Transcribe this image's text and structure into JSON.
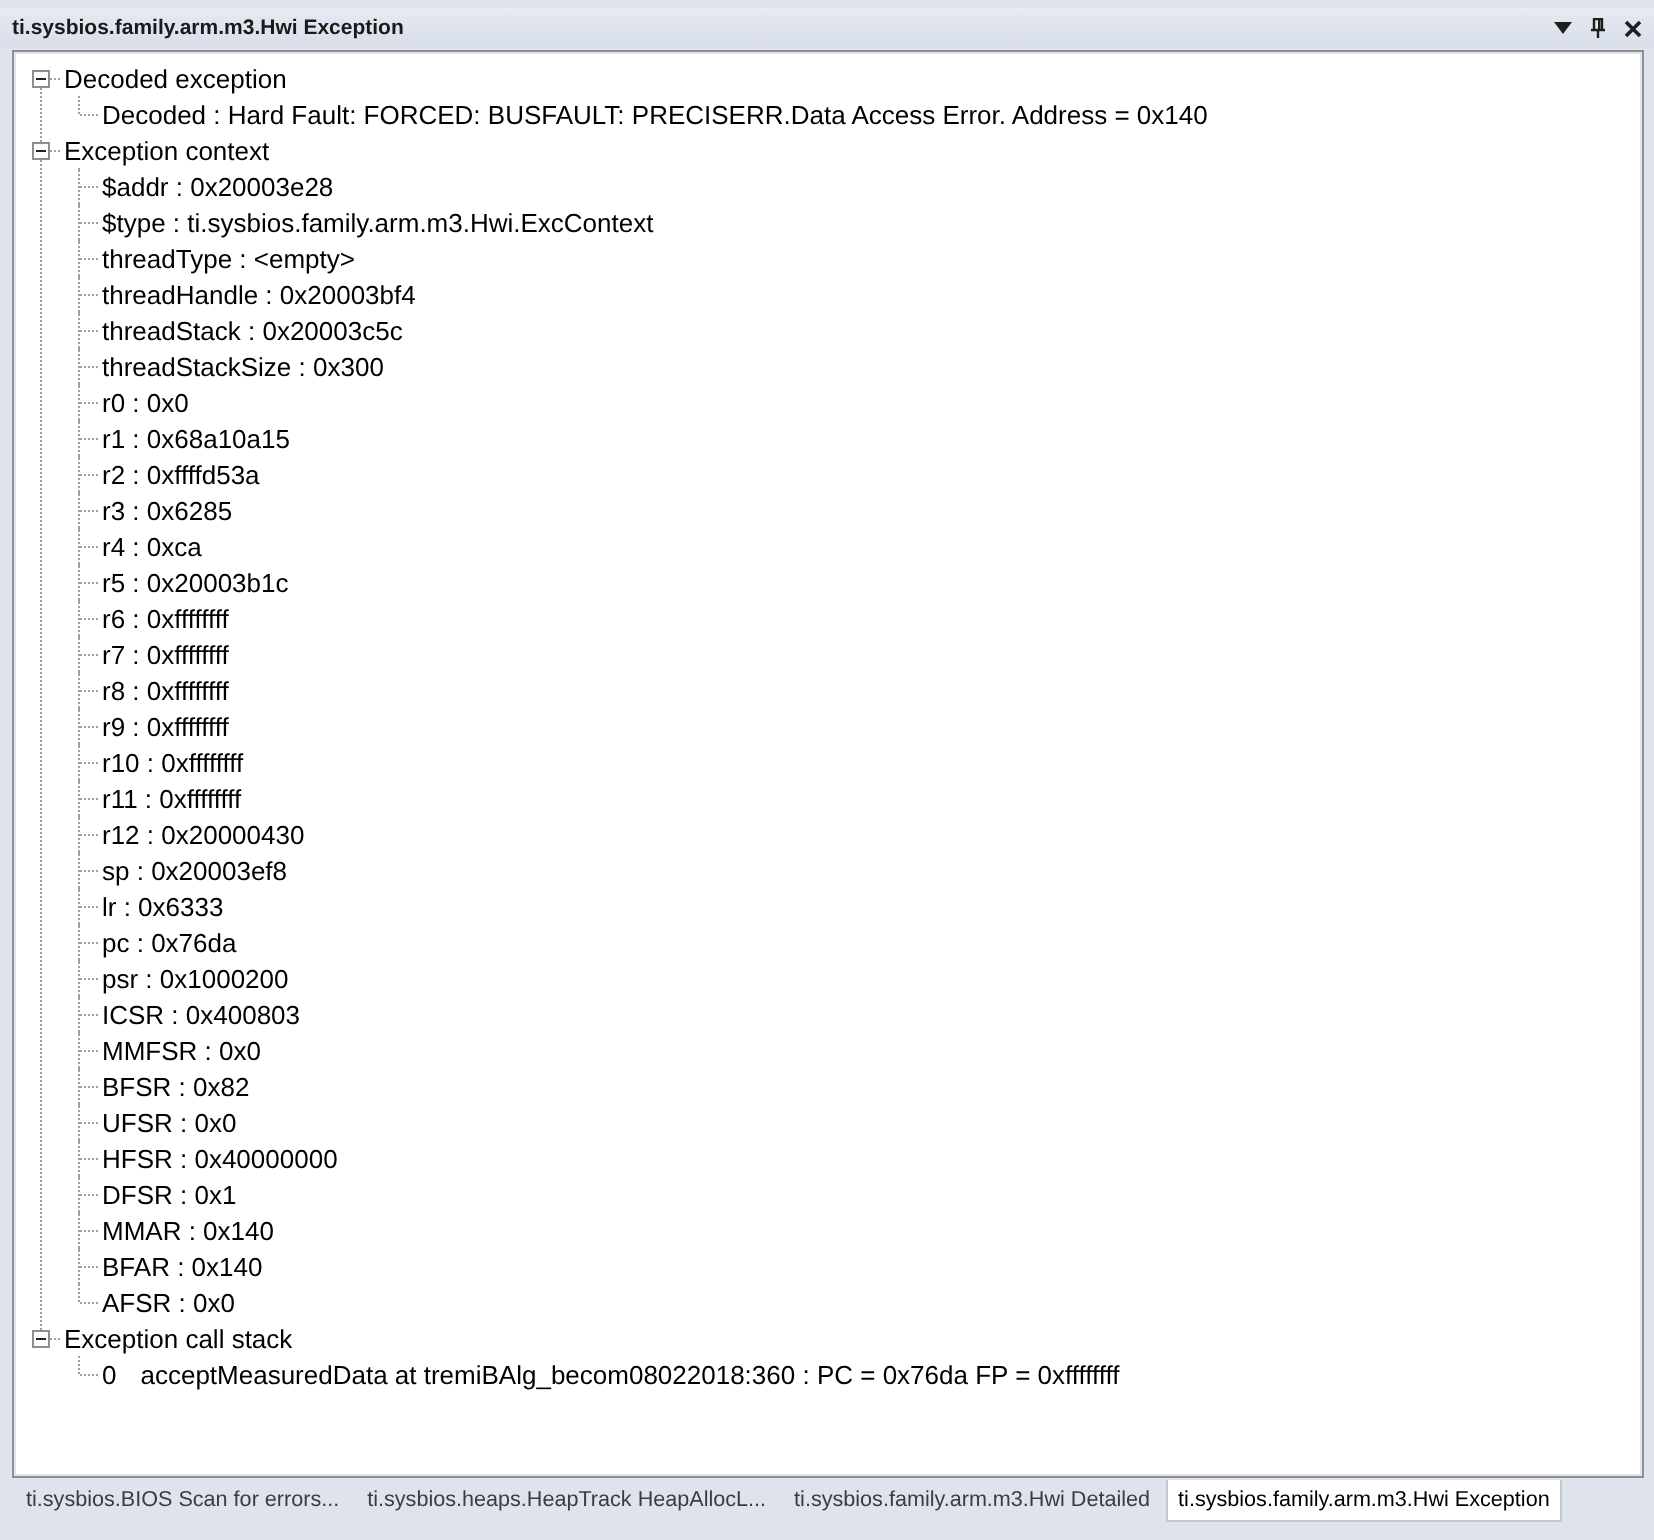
{
  "window": {
    "title": "ti.sysbios.family.arm.m3.Hwi Exception"
  },
  "tree": [
    {
      "label": "Decoded exception",
      "expanded": true,
      "children": [
        {
          "label": "Decoded : Hard Fault: FORCED: BUSFAULT: PRECISERR.Data Access Error. Address = 0x140"
        }
      ]
    },
    {
      "label": "Exception context",
      "expanded": true,
      "children": [
        {
          "label": "$addr : 0x20003e28"
        },
        {
          "label": "$type : ti.sysbios.family.arm.m3.Hwi.ExcContext"
        },
        {
          "label": "threadType : <empty>"
        },
        {
          "label": "threadHandle : 0x20003bf4"
        },
        {
          "label": "threadStack : 0x20003c5c"
        },
        {
          "label": "threadStackSize : 0x300"
        },
        {
          "label": "r0 : 0x0"
        },
        {
          "label": "r1 : 0x68a10a15"
        },
        {
          "label": "r2 : 0xffffd53a"
        },
        {
          "label": "r3 : 0x6285"
        },
        {
          "label": "r4 : 0xca"
        },
        {
          "label": "r5 : 0x20003b1c"
        },
        {
          "label": "r6 : 0xffffffff"
        },
        {
          "label": "r7 : 0xffffffff"
        },
        {
          "label": "r8 : 0xffffffff"
        },
        {
          "label": "r9 : 0xffffffff"
        },
        {
          "label": "r10 : 0xffffffff"
        },
        {
          "label": "r11 : 0xffffffff"
        },
        {
          "label": "r12 : 0x20000430"
        },
        {
          "label": "sp : 0x20003ef8"
        },
        {
          "label": "lr : 0x6333"
        },
        {
          "label": "pc : 0x76da"
        },
        {
          "label": "psr : 0x1000200"
        },
        {
          "label": "ICSR : 0x400803"
        },
        {
          "label": "MMFSR : 0x0"
        },
        {
          "label": "BFSR : 0x82"
        },
        {
          "label": "UFSR : 0x0"
        },
        {
          "label": "HFSR : 0x40000000"
        },
        {
          "label": "DFSR : 0x1"
        },
        {
          "label": "MMAR : 0x140"
        },
        {
          "label": "BFAR : 0x140"
        },
        {
          "label": "AFSR : 0x0"
        }
      ]
    },
    {
      "label": "Exception call stack",
      "expanded": true,
      "children": [
        {
          "index": "0",
          "label": "acceptMeasuredData at tremiBAlg_becom08022018:360 : PC = 0x76da FP = 0xffffffff"
        }
      ]
    }
  ],
  "tabs": [
    {
      "label": "ti.sysbios.BIOS Scan for errors...",
      "selected": false
    },
    {
      "label": "ti.sysbios.heaps.HeapTrack HeapAllocL...",
      "selected": false
    },
    {
      "label": "ti.sysbios.family.arm.m3.Hwi Detailed",
      "selected": false
    },
    {
      "label": "ti.sysbios.family.arm.m3.Hwi Exception",
      "selected": true
    }
  ]
}
